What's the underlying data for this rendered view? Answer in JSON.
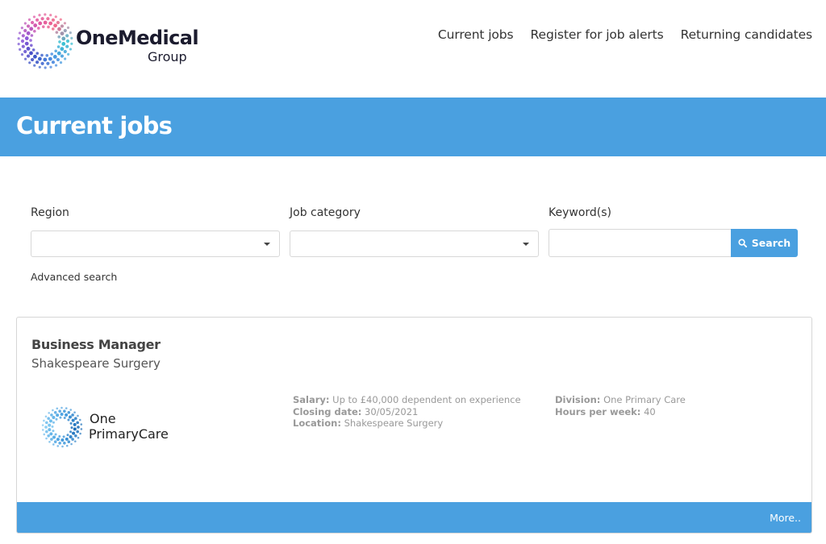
{
  "header": {
    "brand": {
      "name": "OneMedical",
      "sub": "Group"
    },
    "nav": [
      {
        "label": "Current jobs"
      },
      {
        "label": "Register for job alerts"
      },
      {
        "label": "Returning candidates"
      }
    ]
  },
  "banner": {
    "title": "Current jobs"
  },
  "search": {
    "region": {
      "label": "Region",
      "value": ""
    },
    "job_category": {
      "label": "Job category",
      "value": ""
    },
    "keywords": {
      "label": "Keyword(s)",
      "value": "",
      "placeholder": ""
    },
    "search_button": {
      "label": "Search",
      "icon": "search-icon"
    },
    "advanced_search": "Advanced search"
  },
  "job": {
    "title": "Business Manager",
    "employer": "Shakespeare Surgery",
    "logo": {
      "line1": "One",
      "line2": "PrimaryCare"
    },
    "details_left": [
      {
        "label": "Salary:",
        "value": "Up to £40,000 dependent on experience"
      },
      {
        "label": "Closing date:",
        "value": "30/05/2021"
      },
      {
        "label": "Location:",
        "value": "Shakespeare Surgery"
      }
    ],
    "details_right": [
      {
        "label": "Division:",
        "value": "One Primary Care"
      },
      {
        "label": "Hours per week:",
        "value": "40"
      }
    ],
    "more_label": "More.."
  },
  "colors": {
    "accent": "#4aa0e0",
    "text": "#333333",
    "muted": "#999999",
    "border": "#d6d6d6"
  }
}
